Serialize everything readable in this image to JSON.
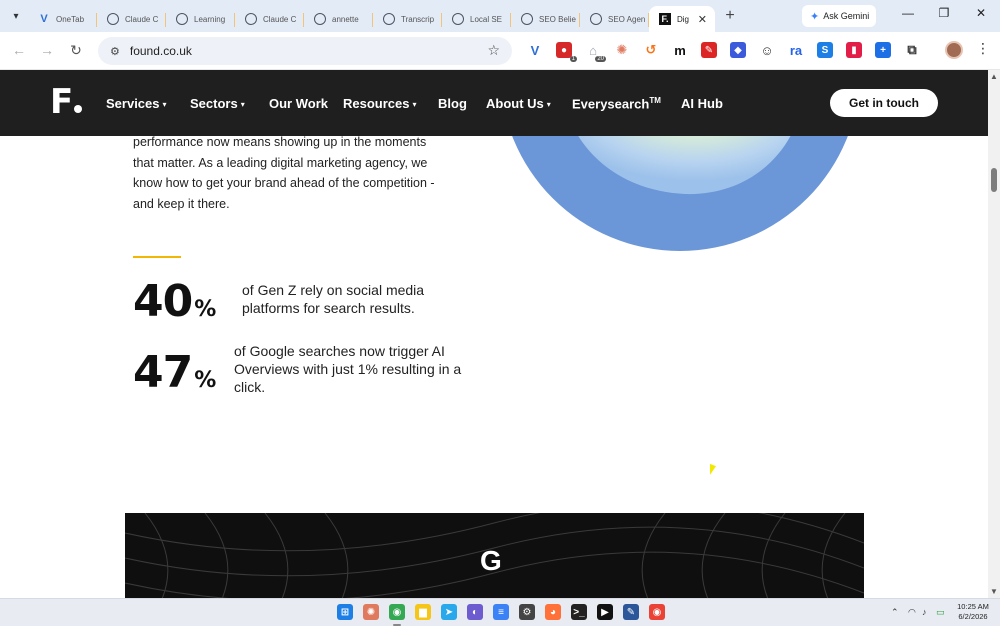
{
  "browser": {
    "tabs": [
      {
        "title": "OneTab",
        "icon": "onetab-icon"
      },
      {
        "title": "Claude C",
        "icon": "globe-icon"
      },
      {
        "title": "Learning",
        "icon": "globe-icon"
      },
      {
        "title": "Claude C",
        "icon": "globe-icon"
      },
      {
        "title": "annette",
        "icon": "globe-icon"
      },
      {
        "title": "Transcrip",
        "icon": "globe-icon"
      },
      {
        "title": "Local SE",
        "icon": "globe-icon"
      },
      {
        "title": "SEO Belie",
        "icon": "globe-icon"
      },
      {
        "title": "SEO Agen",
        "icon": "globe-icon"
      },
      {
        "title": "Dig",
        "icon": "found-favicon",
        "active": true
      }
    ],
    "new_tab_symbol": "+",
    "gemini_label": "Ask Gemini",
    "window_controls": {
      "minimize": "—",
      "restore": "❐",
      "close": "✕"
    },
    "url": "found.co.uk",
    "extensions": [
      {
        "name": "v-extension-icon",
        "glyph": "V",
        "color": "#2f6fd6"
      },
      {
        "name": "red-extension-icon",
        "glyph": "●",
        "color": "#d62828",
        "badge": "1"
      },
      {
        "name": "home-extension-icon",
        "glyph": "⌂",
        "color": "#9ca3af",
        "badge": "20"
      },
      {
        "name": "claude-extension-icon",
        "glyph": "✺",
        "color": "#e07a5f"
      },
      {
        "name": "orange-extension-icon",
        "glyph": "↺",
        "color": "#f97316"
      },
      {
        "name": "m-extension-icon",
        "glyph": "m",
        "color": "#111111"
      },
      {
        "name": "red-pen-extension-icon",
        "glyph": "✎",
        "color": "#dc2626"
      },
      {
        "name": "blue-extension-icon",
        "glyph": "◆",
        "color": "#3b5bdb"
      },
      {
        "name": "smiley-extension-icon",
        "glyph": "☺",
        "color": "#333333"
      },
      {
        "name": "ra-extension-icon",
        "glyph": "ra",
        "color": "#2563eb"
      },
      {
        "name": "circle-extension-icon",
        "glyph": "S",
        "color": "#1d7fe5"
      },
      {
        "name": "pink-extension-icon",
        "glyph": "▮",
        "color": "#e11d48"
      },
      {
        "name": "plus-extension-icon",
        "glyph": "+",
        "color": "#1d6fe5"
      },
      {
        "name": "puzzle-icon",
        "glyph": "⧉",
        "color": "#333333"
      }
    ]
  },
  "site": {
    "logo_letter": "F",
    "nav": [
      {
        "label": "Services",
        "dropdown": true
      },
      {
        "label": "Sectors",
        "dropdown": true
      },
      {
        "label": "Our Work",
        "dropdown": false
      },
      {
        "label": "Resources",
        "dropdown": true
      },
      {
        "label": "Blog",
        "dropdown": false
      },
      {
        "label": "About Us",
        "dropdown": true
      },
      {
        "label": "Everysearch",
        "sup": "TM",
        "dropdown": false
      },
      {
        "label": "AI Hub",
        "dropdown": false
      }
    ],
    "cta_label": "Get in touch"
  },
  "main": {
    "intro_lines": [
      "performance now means showing up in the moments",
      "that matter. As a leading digital marketing agency, we",
      "know how to get your brand ahead of the competition -",
      "and keep it there."
    ],
    "stats": [
      {
        "number": "40",
        "unit": "%",
        "text": "of Gen Z rely on social media platforms for search results."
      },
      {
        "number": "47",
        "unit": "%",
        "text": "of Google searches now trigger AI Overviews with just 1% resulting in a click."
      }
    ],
    "panel_logo": "G"
  },
  "taskbar": {
    "apps": [
      {
        "name": "windows-start-icon",
        "glyph": "⊞",
        "color": "#1d7fe5"
      },
      {
        "name": "claude-app-icon",
        "glyph": "✺",
        "color": "#e07a5f"
      },
      {
        "name": "chrome-icon",
        "glyph": "◉",
        "color": "#34a853",
        "active": true
      },
      {
        "name": "file-explorer-icon",
        "glyph": "▆",
        "color": "#f5c518"
      },
      {
        "name": "telegram-icon",
        "glyph": "➤",
        "color": "#29a9eb"
      },
      {
        "name": "app-icon",
        "glyph": "◐",
        "color": "#6d5bd0"
      },
      {
        "name": "notepad-icon",
        "glyph": "≡",
        "color": "#3b82f6"
      },
      {
        "name": "gear-app-icon",
        "glyph": "⚙",
        "color": "#444444"
      },
      {
        "name": "firefox-icon",
        "glyph": "◕",
        "color": "#ff7139"
      },
      {
        "name": "terminal-icon",
        "glyph": ">_",
        "color": "#222222"
      },
      {
        "name": "media-player-icon",
        "glyph": "▶",
        "color": "#111111"
      },
      {
        "name": "editor-icon",
        "glyph": "✎",
        "color": "#2b579a"
      },
      {
        "name": "chrome-alt-icon",
        "glyph": "◉",
        "color": "#ea4335"
      }
    ],
    "clock_time": "10:25 AM",
    "clock_date": "6/2/2026"
  }
}
